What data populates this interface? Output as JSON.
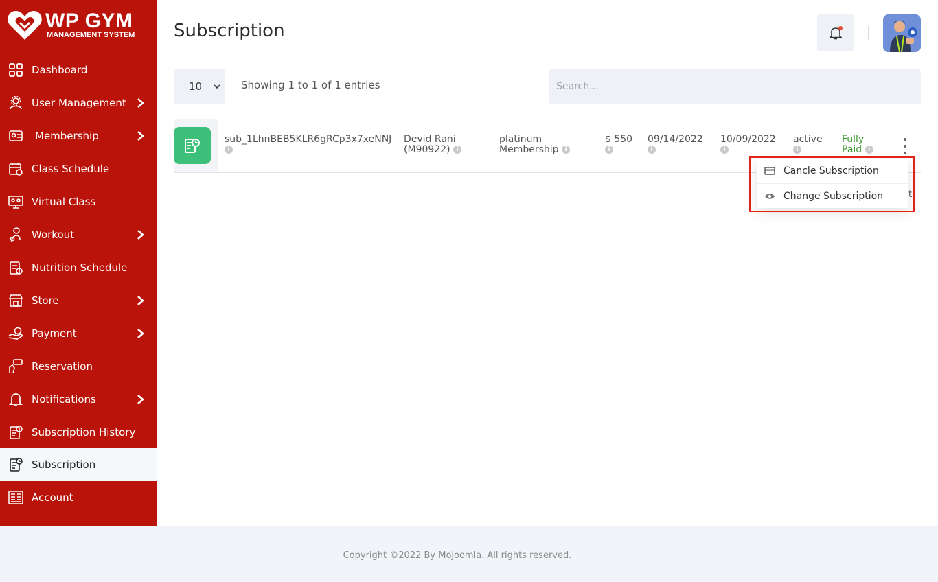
{
  "brand": {
    "title": "WP GYM",
    "subtitle": "MANAGEMENT SYSTEM",
    "color": "#b9130a"
  },
  "sidebar": {
    "items": [
      {
        "label": "Dashboard",
        "icon": "dashboard-grid-icon",
        "has_submenu": false
      },
      {
        "label": "User Management",
        "icon": "users-gear-icon",
        "has_submenu": true
      },
      {
        "label": "Membership",
        "icon": "membership-card-icon",
        "has_submenu": true
      },
      {
        "label": "Class Schedule",
        "icon": "calendar-icon",
        "has_submenu": false
      },
      {
        "label": "Virtual Class",
        "icon": "virtual-class-icon",
        "has_submenu": false
      },
      {
        "label": "Workout",
        "icon": "workout-icon",
        "has_submenu": true
      },
      {
        "label": "Nutrition Schedule",
        "icon": "nutrition-icon",
        "has_submenu": false
      },
      {
        "label": "Store",
        "icon": "store-icon",
        "has_submenu": true
      },
      {
        "label": "Payment",
        "icon": "payment-icon",
        "has_submenu": true
      },
      {
        "label": "Reservation",
        "icon": "reservation-icon",
        "has_submenu": false
      },
      {
        "label": "Notifications",
        "icon": "bell-icon",
        "has_submenu": true
      },
      {
        "label": "Subscription History",
        "icon": "subscription-history-icon",
        "has_submenu": false
      },
      {
        "label": "Subscription",
        "icon": "subscription-icon",
        "has_submenu": false,
        "active": true
      },
      {
        "label": "Account",
        "icon": "account-icon",
        "has_submenu": false
      }
    ]
  },
  "header": {
    "title": "Subscription"
  },
  "table_controls": {
    "page_length": "10",
    "info": "Showing 1 to 1 of 1 entries",
    "search_placeholder": "Search..."
  },
  "rows": [
    {
      "subscription_id": "sub_1LhnBEB5KLR6gRCp3x7xeNNJ",
      "member": "Devid Rani (M90922)",
      "membership": "platinum Membership",
      "amount": "$ 550",
      "start_date": "09/14/2022",
      "end_date": "10/09/2022",
      "status": "active",
      "payment_status": "Fully Paid",
      "payment_status_color": "#3b9a2f"
    }
  ],
  "dropdown": {
    "items": [
      {
        "label": "Cancle Subscription",
        "icon": "credit-card-icon"
      },
      {
        "label": "Change Subscription",
        "icon": "eye-icon"
      }
    ]
  },
  "footer": {
    "text": "Copyright ©2022 By Mojoomla. All rights reserved."
  }
}
